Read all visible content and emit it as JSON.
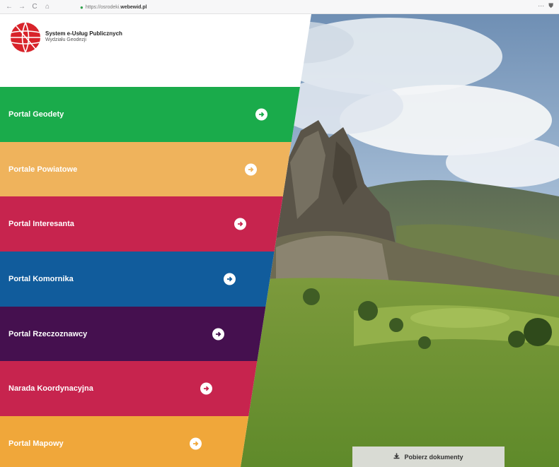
{
  "browser": {
    "back": "←",
    "forward": "→",
    "reload": "C",
    "home": "⌂",
    "url_prefix": "https://osrodeki.",
    "url_domain": "webewid.pl",
    "menu": "···",
    "shield": "⛊"
  },
  "brand": {
    "title": "System e-Usług Publicznych",
    "subtitle": "Wydziału Geodezji"
  },
  "portals": [
    {
      "label": "Portal Geodety",
      "color": "#1aab4b"
    },
    {
      "label": "Portale Powiatowe",
      "color": "#efb35c"
    },
    {
      "label": "Portal Interesanta",
      "color": "#c7244e"
    },
    {
      "label": "Portal Komornika",
      "color": "#115c9c"
    },
    {
      "label": "Portal Rzeczoznawcy",
      "color": "#45104f"
    },
    {
      "label": "Narada Koordynacyjna",
      "color": "#c7244e"
    },
    {
      "label": "Portal Mapowy",
      "color": "#f0a73a"
    }
  ],
  "download": {
    "label": "Pobierz dokumenty"
  }
}
